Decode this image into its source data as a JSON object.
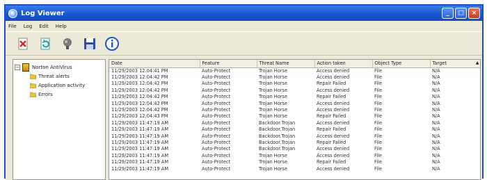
{
  "window": {
    "title": "Log Viewer"
  },
  "menu": [
    "File",
    "Log",
    "Edit",
    "Help"
  ],
  "toolbar": [
    {
      "name": "delete-log-icon"
    },
    {
      "name": "refresh-icon"
    },
    {
      "name": "filter-icon"
    },
    {
      "name": "save-icon"
    },
    {
      "name": "info-icon"
    }
  ],
  "tree": {
    "root": "Norton AntiVirus",
    "children": [
      "Threat alerts",
      "Application activity",
      "Errors"
    ]
  },
  "table": {
    "columns": [
      "Date",
      "Feature",
      "Threat Name",
      "Action taken",
      "Object Type",
      "Target"
    ],
    "rows": [
      [
        "11/29/2003 12:04:41 PM",
        "Auto-Protect",
        "Trojan Horse",
        "Access denied",
        "File",
        "N/A"
      ],
      [
        "11/29/2003 12:04:42 PM",
        "Auto-Protect",
        "Trojan Horse",
        "Access denied",
        "File",
        "N/A"
      ],
      [
        "11/29/2003 12:04:42 PM",
        "Auto-Protect",
        "Trojan Horse",
        "Repair Failed",
        "File",
        "N/A"
      ],
      [
        "11/29/2003 12:04:42 PM",
        "Auto-Protect",
        "Trojan Horse",
        "Access denied",
        "File",
        "N/A"
      ],
      [
        "11/29/2003 12:04:42 PM",
        "Auto-Protect",
        "Trojan Horse",
        "Repair Failed",
        "File",
        "N/A"
      ],
      [
        "11/29/2003 12:04:42 PM",
        "Auto-Protect",
        "Trojan Horse",
        "Access denied",
        "File",
        "N/A"
      ],
      [
        "11/29/2003 12:04:42 PM",
        "Auto-Protect",
        "Trojan Horse",
        "Access denied",
        "File",
        "N/A"
      ],
      [
        "11/29/2003 12:04:43 PM",
        "Auto-Protect",
        "Trojan Horse",
        "Repair Failed",
        "File",
        "N/A"
      ],
      [
        "11/29/2003 11:47:19 AM",
        "Auto-Protect",
        "Backdoor.Trojan",
        "Access denied",
        "File",
        "N/A"
      ],
      [
        "11/29/2003 11:47:19 AM",
        "Auto-Protect",
        "Backdoor.Trojan",
        "Repair Failed",
        "File",
        "N/A"
      ],
      [
        "11/29/2003 11:47:19 AM",
        "Auto-Protect",
        "Backdoor.Trojan",
        "Access denied",
        "File",
        "N/A"
      ],
      [
        "11/29/2003 11:47:19 AM",
        "Auto-Protect",
        "Backdoor.Trojan",
        "Repair Failed",
        "File",
        "N/A"
      ],
      [
        "11/29/2003 11:47:19 AM",
        "Auto-Protect",
        "Backdoor.Trojan",
        "Access denied",
        "File",
        "N/A"
      ],
      [
        "11/29/2003 11:47:19 AM",
        "Auto-Protect",
        "Trojan Horse",
        "Access denied",
        "File",
        "N/A"
      ],
      [
        "11/29/2003 11:47:19 AM",
        "Auto-Protect",
        "Trojan Horse",
        "Repair Failed",
        "File",
        "N/A"
      ],
      [
        "11/29/2003 11:47:19 AM",
        "Auto-Protect",
        "Trojan Horse",
        "Access denied",
        "File",
        "N/A"
      ]
    ]
  },
  "colors": {
    "titlebar": "#1a55d2",
    "chrome": "#ece9d8",
    "folder": "#f5c431"
  }
}
